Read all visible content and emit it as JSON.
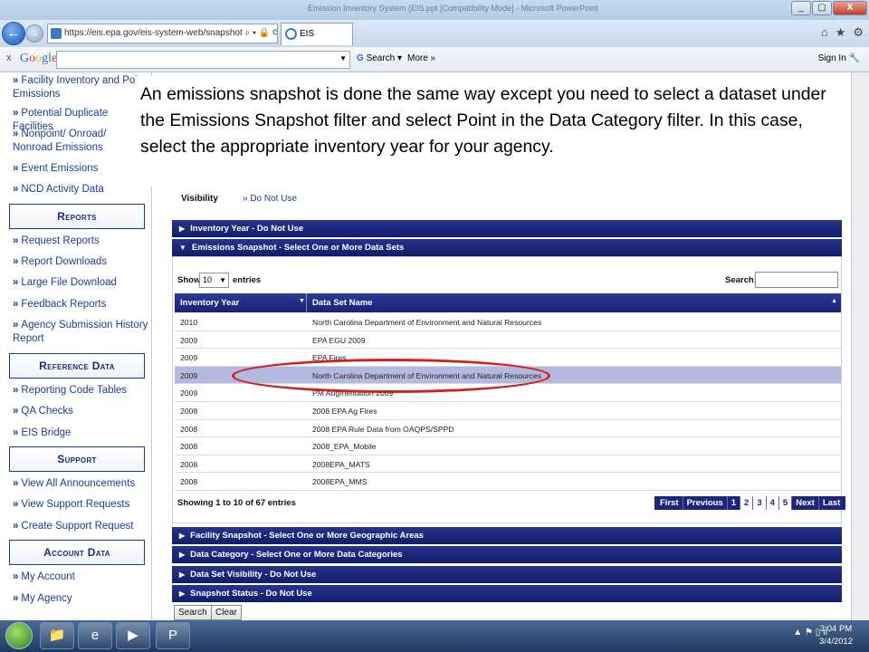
{
  "window": {
    "title": "Emission Inventory System (EIS.ppt [Compatibility Mode] - Microsoft PowerPoint",
    "minimize": "_",
    "maximize": "▢",
    "close": "X"
  },
  "browser": {
    "url": "https://eis.epa.gov/eis-system-web/snapshot",
    "url_suffix": "⌕ ▾ 🔒 ⟳ ✕",
    "tab_title": "EIS",
    "right_icons": [
      "⌂",
      "★",
      "⚙"
    ]
  },
  "google_toolbar": {
    "close": "x",
    "logo": "Google",
    "search_label": "Search",
    "more_label": "More »",
    "sign_in": "Sign In"
  },
  "sidebar": {
    "items_top": [
      {
        "label": "Facility Inventory and Point Emissions"
      },
      {
        "label": "Potential Duplicate Facilities"
      },
      {
        "label": "Nonpoint/ Onroad/ Nonroad Emissions"
      },
      {
        "label": "Event Emissions"
      },
      {
        "label": "NCD Activity Data"
      }
    ],
    "reports_heading": "Reports",
    "reports": [
      {
        "label": "Request Reports"
      },
      {
        "label": "Report Downloads"
      },
      {
        "label": "Large File Download"
      },
      {
        "label": "Feedback Reports"
      },
      {
        "label": "Agency Submission History Report"
      }
    ],
    "reference_heading": "Reference Data",
    "reference": [
      {
        "label": "Reporting Code Tables"
      },
      {
        "label": "QA Checks"
      },
      {
        "label": "EIS Bridge"
      }
    ],
    "support_heading": "Support",
    "support": [
      {
        "label": "View All Announcements"
      },
      {
        "label": "View Support Requests"
      },
      {
        "label": "Create Support Request"
      }
    ],
    "account_heading": "Account Data",
    "account": [
      {
        "label": "My Account"
      },
      {
        "label": "My Agency"
      }
    ]
  },
  "callout": {
    "text": "An emissions snapshot is done the same way except you need to select a dataset under the Emissions Snapshot filter and select Point in the Data Category filter.  In this case, select the appropriate inventory year for your agency."
  },
  "main": {
    "visibility_label": "Visibility",
    "visibility_value": "» Do Not Use",
    "inventory_year_panel": "Inventory Year - Do Not Use",
    "emissions_panel": "Emissions Snapshot - Select One or More Data Sets",
    "show_label": "Show",
    "show_value": "10",
    "entries_label": "entries",
    "search_label": "Search:",
    "col_year": "Inventory Year",
    "col_dataset": "Data Set Name",
    "rows": [
      {
        "year": "2010",
        "name": "North Carolina Department of Environment and Natural Resources"
      },
      {
        "year": "2009",
        "name": "EPA EGU 2009"
      },
      {
        "year": "2009",
        "name": "EPA Fires"
      },
      {
        "year": "2009",
        "name": "North Carolina Department of Environment and Natural Resources"
      },
      {
        "year": "2009",
        "name": "PM Augmentation 2009"
      },
      {
        "year": "2008",
        "name": "2008 EPA Ag Fires"
      },
      {
        "year": "2008",
        "name": "2008 EPA Rule Data from OAQPS/SPPD"
      },
      {
        "year": "2008",
        "name": "2008_EPA_Mobile"
      },
      {
        "year": "2008",
        "name": "2008EPA_MATS"
      },
      {
        "year": "2008",
        "name": "2008EPA_MMS"
      }
    ],
    "showing_info": "Showing 1 to 10 of 67 entries",
    "pager": {
      "first": "First",
      "previous": "Previous",
      "pages": [
        "1",
        "2",
        "3",
        "4",
        "5"
      ],
      "next": "Next",
      "last": "Last"
    },
    "facility_panel": "Facility Snapshot - Select One or More Geographic Areas",
    "category_panel": "Data Category - Select One or More Data Categories",
    "visibility_panel": "Data Set Visibility - Do Not Use",
    "status_panel": "Snapshot Status - Do Not Use",
    "search_button": "Search",
    "clear_button": "Clear"
  },
  "taskbar": {
    "time": "3:04 PM",
    "date": "3/4/2012",
    "tray": "▲ ⚑ ▯ ıl"
  },
  "colors": {
    "panel": "#17227a",
    "link": "#1c3d8f",
    "selected_row": "#b4b9df",
    "highlight_ellipse": "#d12020"
  }
}
